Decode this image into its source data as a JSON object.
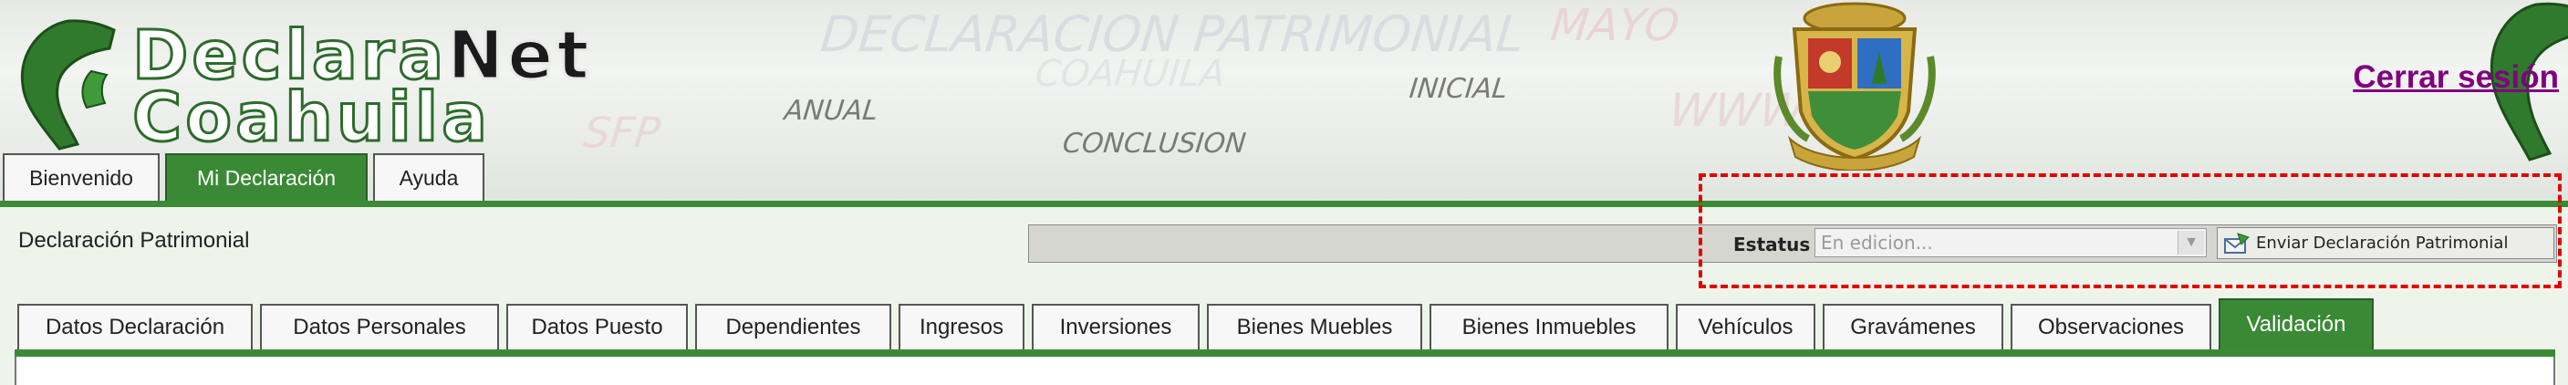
{
  "header": {
    "logo_line1_a": "Declara",
    "logo_line1_b": "Net",
    "logo_line2": "Coahuila",
    "watermarks": {
      "title": "DECLARACION PATRIMONIAL",
      "month": "MAYO",
      "state": "COAHUILA",
      "initial": "INICIAL",
      "annual": "ANUAL",
      "conclusion": "CONCLUSION",
      "sfp": "SFP",
      "www": "WWW"
    },
    "logout_label": "Cerrar sesión"
  },
  "top_tabs": [
    {
      "label": "Bienvenido",
      "active": false
    },
    {
      "label": "Mi Declaración",
      "active": true
    },
    {
      "label": "Ayuda",
      "active": false
    }
  ],
  "panel": {
    "title": "Declaración Patrimonial",
    "status_label": "Estatus",
    "status_value": "En edicion...",
    "send_button_label": "Enviar Declaración Patrimonial"
  },
  "section_tabs": [
    {
      "label": "Datos Declaración",
      "active": false
    },
    {
      "label": "Datos Personales",
      "active": false
    },
    {
      "label": "Datos Puesto",
      "active": false
    },
    {
      "label": "Dependientes",
      "active": false
    },
    {
      "label": "Ingresos",
      "active": false
    },
    {
      "label": "Inversiones",
      "active": false
    },
    {
      "label": "Bienes Muebles",
      "active": false
    },
    {
      "label": "Bienes Inmuebles",
      "active": false
    },
    {
      "label": "Vehículos",
      "active": false
    },
    {
      "label": "Gravámenes",
      "active": false
    },
    {
      "label": "Observaciones",
      "active": false
    },
    {
      "label": "Validación",
      "active": true
    }
  ],
  "colors": {
    "accent_green": "#3a8a35",
    "highlight_red": "#e20000",
    "logout_purple": "#800080"
  },
  "icons": {
    "send": "send-envelope-icon",
    "dropdown": "chevron-down-icon",
    "crest": "state-crest-icon",
    "map": "coahuila-map-icon"
  }
}
